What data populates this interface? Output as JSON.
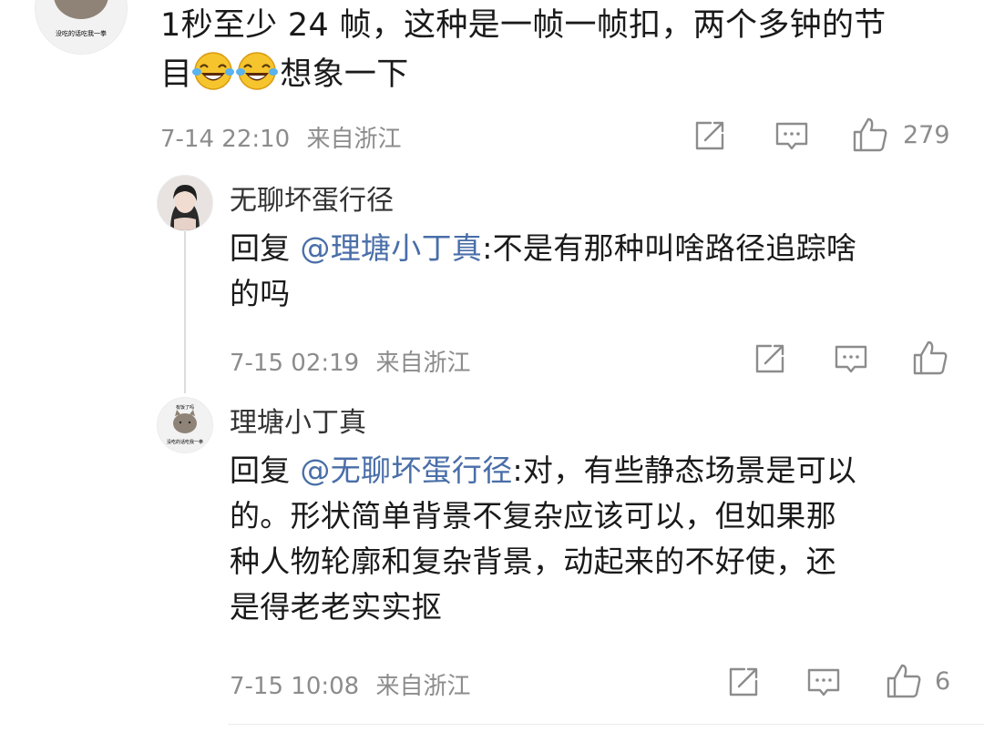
{
  "comment_main": {
    "avatar_caption": "没吃的话吃我一拳",
    "text_line1": "1秒至少 24 帧，这种是一帧一帧扣，两个多钟的节",
    "text_line2_prefix": "目",
    "emojis": [
      "laugh-cry-emoji",
      "laugh-cry-emoji"
    ],
    "text_line2_suffix": "想象一下",
    "timestamp": "7-14 22:10",
    "location": "来自浙江",
    "like_count": "279"
  },
  "reply_1": {
    "username": "无聊坏蛋行径",
    "reply_prefix": "回复",
    "mention": "@理塘小丁真",
    "text_line1": ":不是有那种叫啥路径追踪啥",
    "text_line2": "的吗",
    "timestamp": "7-15 02:19",
    "location": "来自浙江"
  },
  "reply_2": {
    "username": "理塘小丁真",
    "avatar_top_caption": "有饭了吗",
    "avatar_caption": "没吃的话吃我一拳",
    "reply_prefix": "回复",
    "mention": "@无聊坏蛋行径",
    "text_line1": ":对，有些静态场景是可以",
    "text_line2": "的。形状简单背景不复杂应该可以，但如果那",
    "text_line3": "种人物轮廓和复杂背景，动起来的不好使，还",
    "text_line4": "是得老老实实抠",
    "timestamp": "7-15 10:08",
    "location": "来自浙江",
    "like_count": "6"
  },
  "icons": {
    "share": "share-icon",
    "comment": "comment-icon",
    "like": "thumbs-up-icon"
  }
}
